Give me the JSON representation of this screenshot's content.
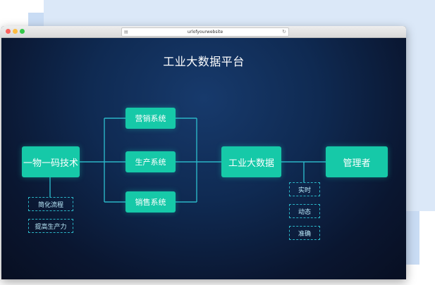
{
  "browser": {
    "url": "urlofyourwebsite"
  },
  "diagram": {
    "title": "工业大数据平台",
    "nodes": {
      "source": "一物一码技术",
      "sales_system": "营销系统",
      "production_system": "生产系统",
      "distribution_system": "销售系统",
      "big_data": "工业大数据",
      "manager": "管理者"
    },
    "source_tags": [
      "简化流程",
      "提高生产力"
    ],
    "manager_tags": [
      "实时",
      "动态",
      "准确"
    ]
  },
  "colors": {
    "node": "#16c9a8",
    "connector": "#2bb6c7",
    "background": "#0f2a52"
  }
}
